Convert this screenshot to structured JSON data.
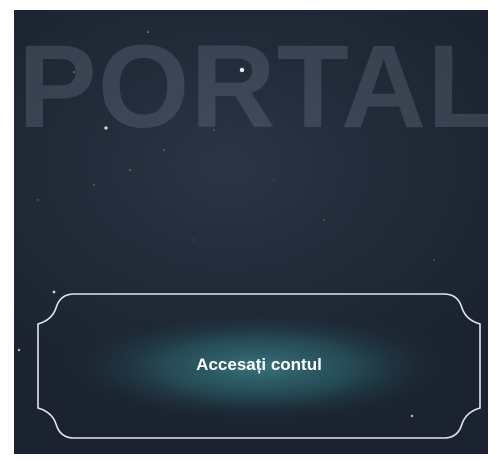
{
  "portal": {
    "title": "PORTAL",
    "login_button_label": "Accesați contul"
  },
  "colors": {
    "background": "#222b39",
    "title_text": "#969fb4",
    "button_glow": "#2f6a72",
    "button_border": "#dfe6ee",
    "button_text": "#ffffff"
  },
  "icons": [
    "sparkle-icon"
  ]
}
